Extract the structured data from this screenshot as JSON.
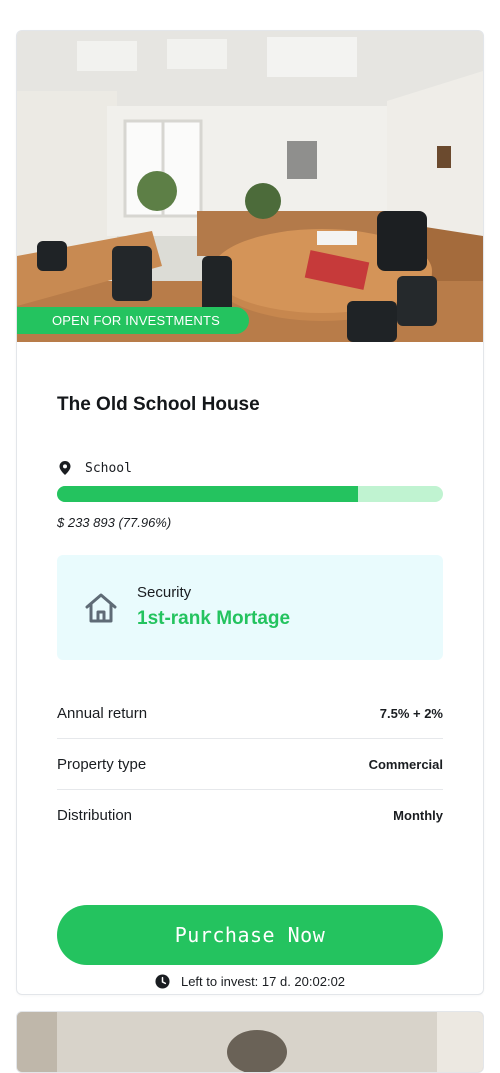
{
  "listing": {
    "badge": "OPEN FOR INVESTMENTS",
    "photo_subject": "classroom-conference-room",
    "title": "The Old School House",
    "category_icon": "location-pin-icon",
    "category": "School",
    "funding_progress": 0.7796,
    "raised_text": "$ 233 893 (77.96%)",
    "security": {
      "icon": "house-icon",
      "label": "Security",
      "value": "1st-rank Mortage"
    },
    "details": [
      {
        "label": "Annual return",
        "value": "7.5% + 2%"
      },
      {
        "label": "Property type",
        "value": "Commercial"
      },
      {
        "label": "Distribution",
        "value": "Monthly"
      }
    ],
    "purchase_label": "Purchase Now",
    "countdown_icon": "clock-icon",
    "countdown_text": "Left to invest: 17 d. 20:02:02"
  },
  "colors": {
    "accent": "#24c35f",
    "progress_track": "#c0f3d1",
    "security_bg": "#e9fbfd",
    "text": "#1a1d21"
  }
}
